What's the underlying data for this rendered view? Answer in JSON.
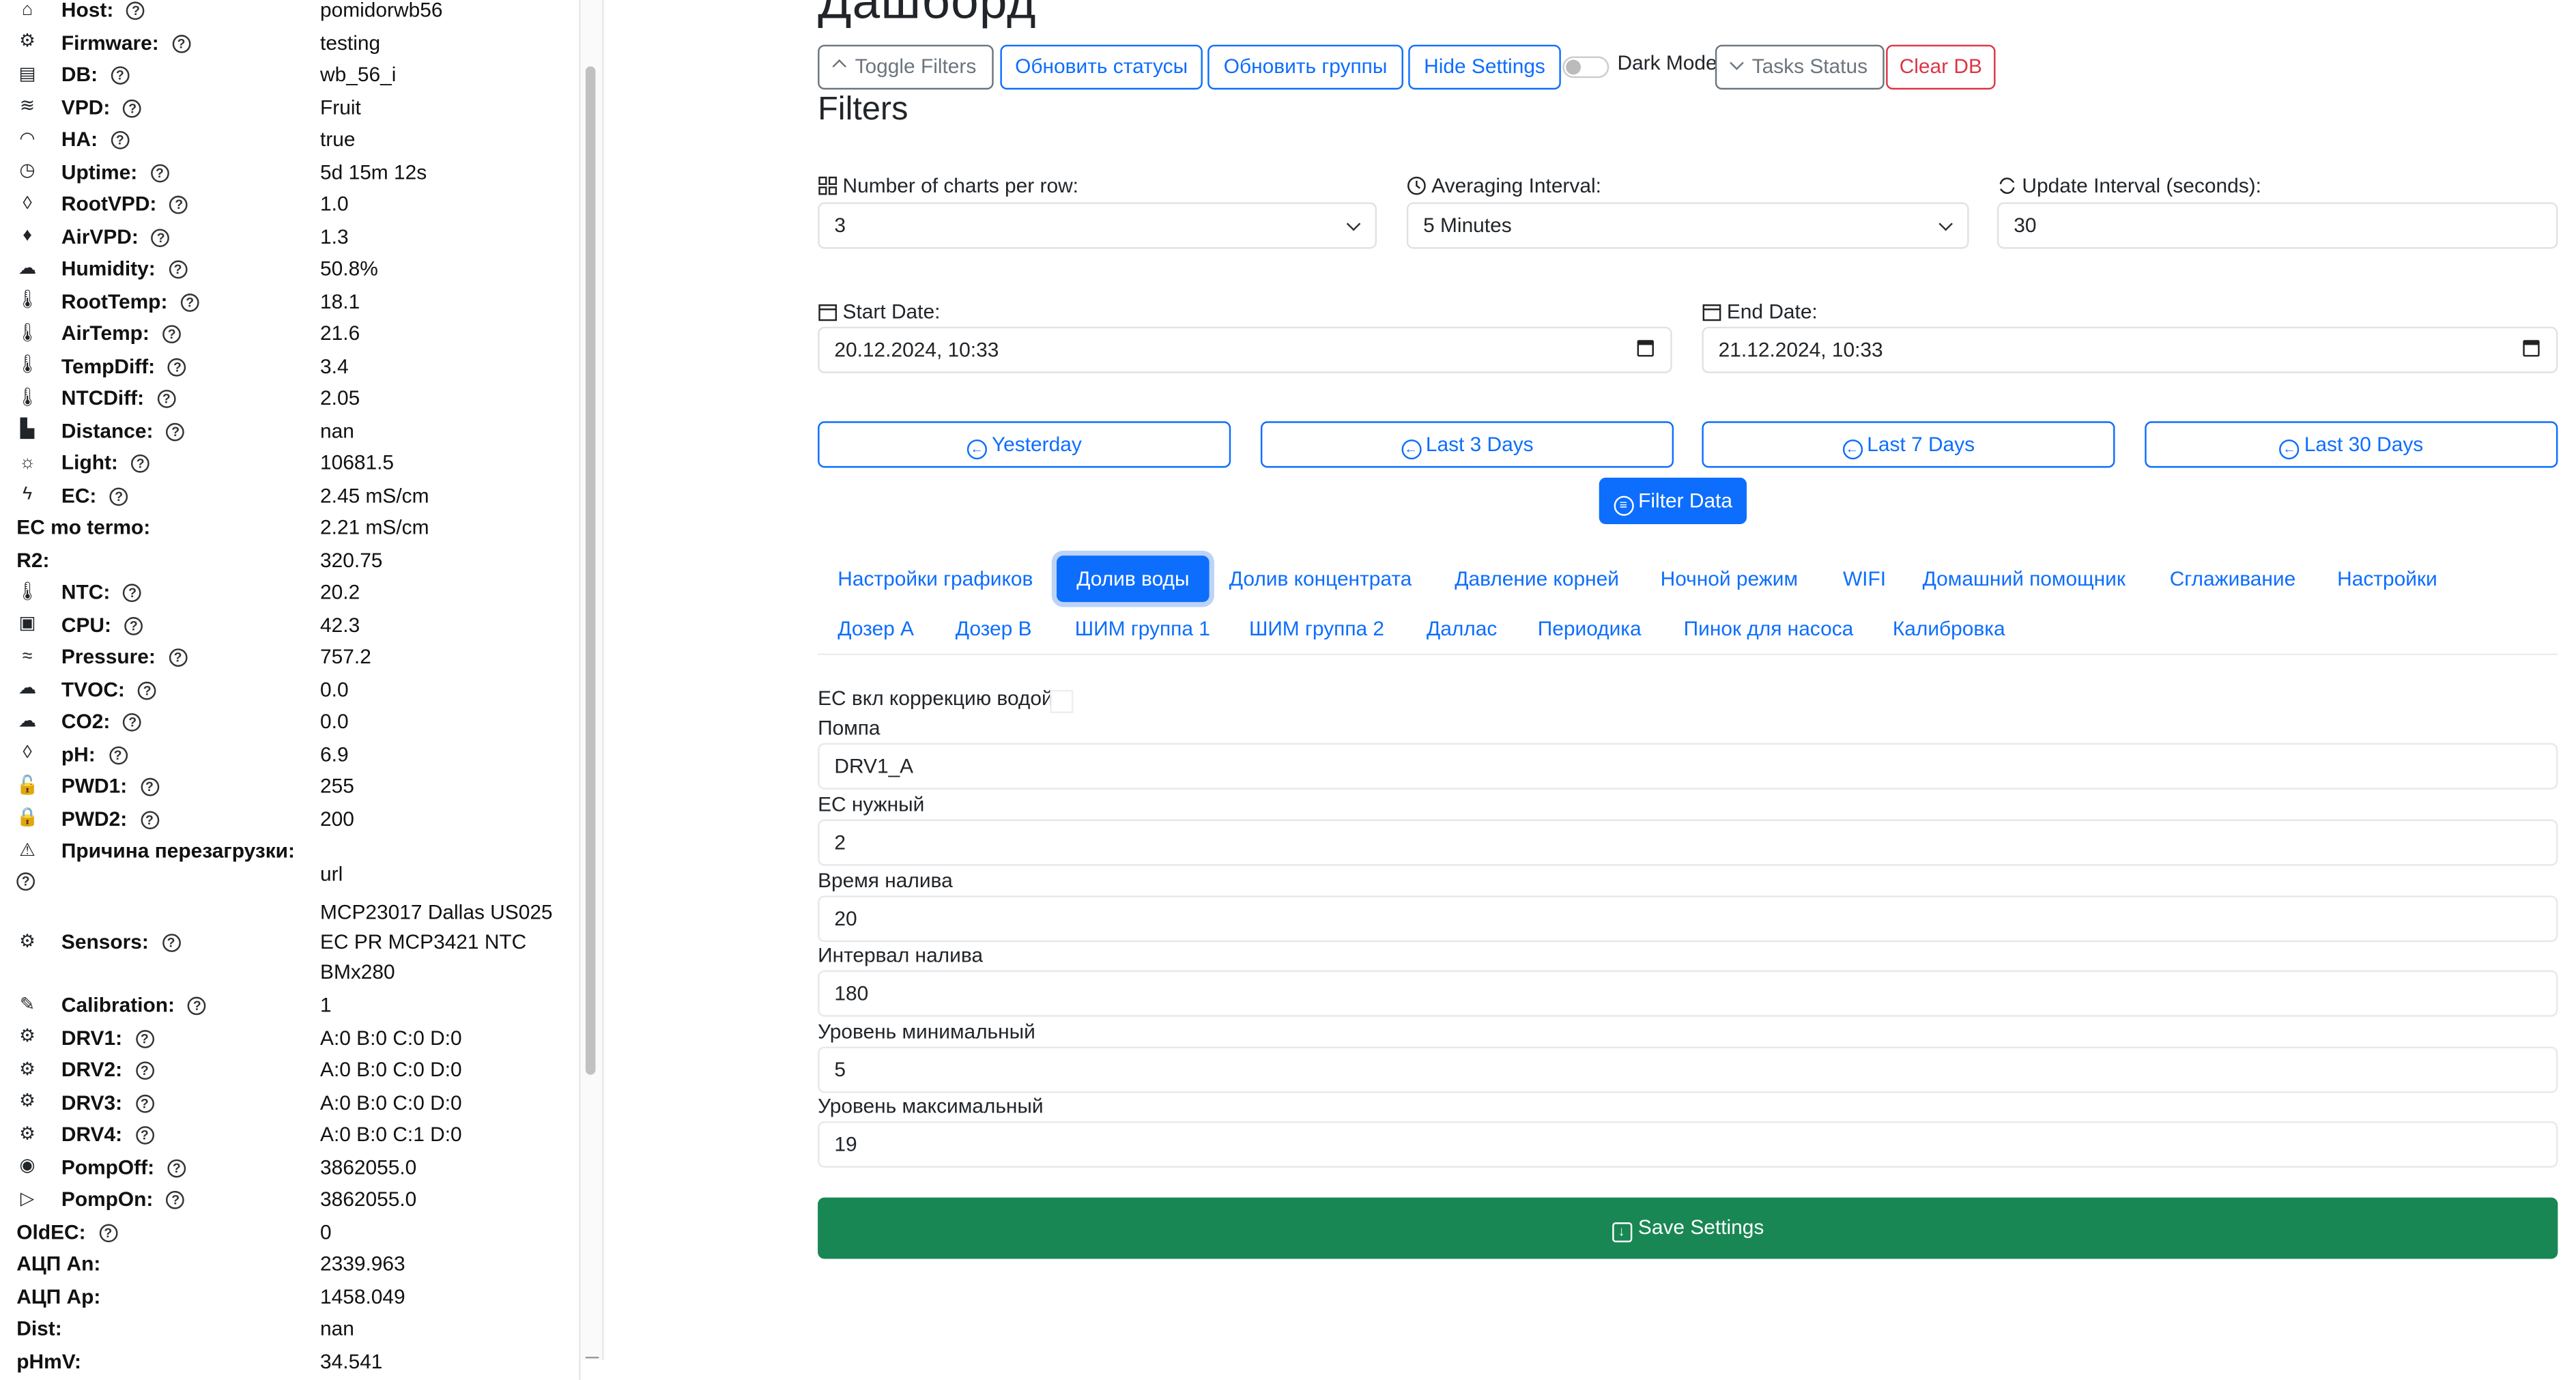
{
  "sidebar": {
    "rows": [
      {
        "icon": "home-icon",
        "label": "Host:",
        "help": true,
        "value": "pomidorwb56"
      },
      {
        "icon": "gear-icon",
        "label": "Firmware:",
        "help": true,
        "value": "testing"
      },
      {
        "icon": "database-icon",
        "label": "DB:",
        "help": true,
        "value": "wb_56_i"
      },
      {
        "icon": "waves-icon",
        "label": "VPD:",
        "help": true,
        "value": "Fruit"
      },
      {
        "icon": "wifi-icon",
        "label": "HA:",
        "help": true,
        "value": "true"
      },
      {
        "icon": "clock-icon",
        "label": "Uptime:",
        "help": true,
        "value": "5d 15m 12s"
      },
      {
        "icon": "droplet-icon",
        "label": "RootVPD:",
        "help": true,
        "value": "1.0"
      },
      {
        "icon": "droplet-fill-icon",
        "label": "AirVPD:",
        "help": true,
        "value": "1.3"
      },
      {
        "icon": "cloud-rain-icon",
        "label": "Humidity:",
        "help": true,
        "value": "50.8%"
      },
      {
        "icon": "thermometer-snow-icon",
        "label": "RootTemp:",
        "help": true,
        "value": "18.1"
      },
      {
        "icon": "thermometer-icon",
        "label": "AirTemp:",
        "help": true,
        "value": "21.6"
      },
      {
        "icon": "thermometer-half-icon",
        "label": "TempDiff:",
        "help": true,
        "value": "3.4"
      },
      {
        "icon": "thermometer-snow-icon",
        "label": "NTCDiff:",
        "help": true,
        "value": "2.05"
      },
      {
        "icon": "rulers-icon",
        "label": "Distance:",
        "help": true,
        "value": "nan"
      },
      {
        "icon": "sun-icon",
        "label": "Light:",
        "help": true,
        "value": "10681.5"
      },
      {
        "icon": "lightning-icon",
        "label": "EC:",
        "help": true,
        "value": "2.45 mS/cm"
      },
      {
        "icon": "",
        "label": "EC mo termo:",
        "help": false,
        "value": "2.21 mS/cm"
      },
      {
        "icon": "",
        "label": "R2:",
        "help": false,
        "value": "320.75"
      },
      {
        "icon": "thermometer-icon",
        "label": "NTC:",
        "help": true,
        "value": "20.2"
      },
      {
        "icon": "cpu-icon",
        "label": "CPU:",
        "help": true,
        "value": "42.3"
      },
      {
        "icon": "wind-icon",
        "label": "Pressure:",
        "help": true,
        "value": "757.2"
      },
      {
        "icon": "cloud-haze-icon",
        "label": "TVOC:",
        "help": true,
        "value": "0.0"
      },
      {
        "icon": "cloud-haze-icon",
        "label": "CO2:",
        "help": true,
        "value": "0.0"
      },
      {
        "icon": "droplet-icon",
        "label": "pH:",
        "help": true,
        "value": "6.9"
      },
      {
        "icon": "lock-icon",
        "label": "PWD1:",
        "help": true,
        "value": "255"
      },
      {
        "icon": "lock-fill-icon",
        "label": "PWD2:",
        "help": true,
        "value": "200"
      },
      {
        "icon": "warning-icon",
        "label": "Причина перезагрузки:",
        "help": true,
        "value": "url"
      },
      {
        "icon": "gear-icon",
        "label": "Sensors:",
        "help": true,
        "value": "MCP23017 Dallas US025 EC PR MCP3421 NTC BMx280"
      },
      {
        "icon": "wrench-icon",
        "label": "Calibration:",
        "help": true,
        "value": "1"
      },
      {
        "icon": "gear-icon",
        "label": "DRV1:",
        "help": true,
        "value": "A:0 B:0 C:0 D:0"
      },
      {
        "icon": "gear-icon",
        "label": "DRV2:",
        "help": true,
        "value": "A:0 B:0 C:0 D:0"
      },
      {
        "icon": "gear-icon",
        "label": "DRV3:",
        "help": true,
        "value": "A:0 B:0 C:0 D:0"
      },
      {
        "icon": "gear-icon",
        "label": "DRV4:",
        "help": true,
        "value": "A:0 B:0 C:1 D:0"
      },
      {
        "icon": "stop-circle-icon",
        "label": "PompOff:",
        "help": true,
        "value": "3862055.0"
      },
      {
        "icon": "play-circle-icon",
        "label": "PompOn:",
        "help": true,
        "value": "3862055.0"
      },
      {
        "icon": "",
        "label": "OldEC:",
        "help": true,
        "value": "0"
      },
      {
        "icon": "",
        "label": "АЦП An:",
        "help": false,
        "value": "2339.963"
      },
      {
        "icon": "",
        "label": "АЦП Ap:",
        "help": false,
        "value": "1458.049"
      },
      {
        "icon": "",
        "label": "Dist:",
        "help": false,
        "value": "nan"
      },
      {
        "icon": "",
        "label": "pHmV:",
        "help": false,
        "value": "34.541"
      }
    ]
  },
  "header": {
    "title": "Дашборд",
    "buttons": {
      "toggle_filters": "Toggle Filters",
      "update_statuses": "Обновить статусы",
      "update_groups": "Обновить группы",
      "hide_settings": "Hide Settings",
      "dark_mode": "Dark Mode",
      "tasks_status": "Tasks Status",
      "clear_db": "Clear DB"
    }
  },
  "filters": {
    "heading": "Filters",
    "charts_per_row_label": "Number of charts per row:",
    "charts_per_row_value": "3",
    "averaging_label": "Averaging Interval:",
    "averaging_value": "5 Minutes",
    "update_interval_label": "Update Interval (seconds):",
    "update_interval_value": "30",
    "start_date_label": "Start Date:",
    "start_date_value": "20.12.2024, 10:33",
    "end_date_label": "End Date:",
    "end_date_value": "21.12.2024, 10:33",
    "quick": [
      "Yesterday",
      "Last 3 Days",
      "Last 7 Days",
      "Last 30 Days"
    ],
    "filter_button": "Filter Data"
  },
  "tabs": {
    "row1": [
      "Настройки графиков",
      "Долив воды",
      "Долив концентрата",
      "Давление корней",
      "Ночной режим",
      "WIFI",
      "Домашний помощник",
      "Сглаживание",
      "Настройки"
    ],
    "row2": [
      "Дозер A",
      "Дозер B",
      "ШИМ группа 1",
      "ШИМ группа 2",
      "Даллас",
      "Периодика",
      "Пинок для насоса",
      "Калибровка"
    ],
    "active": "Долив воды"
  },
  "settings": {
    "ec_correction_label": "EC вкл коррекцию водой",
    "fields": [
      {
        "label": "Помпа",
        "value": "DRV1_A"
      },
      {
        "label": "EC нужный",
        "value": "2"
      },
      {
        "label": "Время налива",
        "value": "20"
      },
      {
        "label": "Интервал налива",
        "value": "180"
      },
      {
        "label": "Уровень минимальный",
        "value": "5"
      },
      {
        "label": "Уровень максимальный",
        "value": "19"
      }
    ],
    "save_button": "Save Settings"
  },
  "colors": {
    "primary": "#0d6efd",
    "success": "#198754",
    "danger": "#dc3545",
    "secondary": "#6c757d"
  }
}
